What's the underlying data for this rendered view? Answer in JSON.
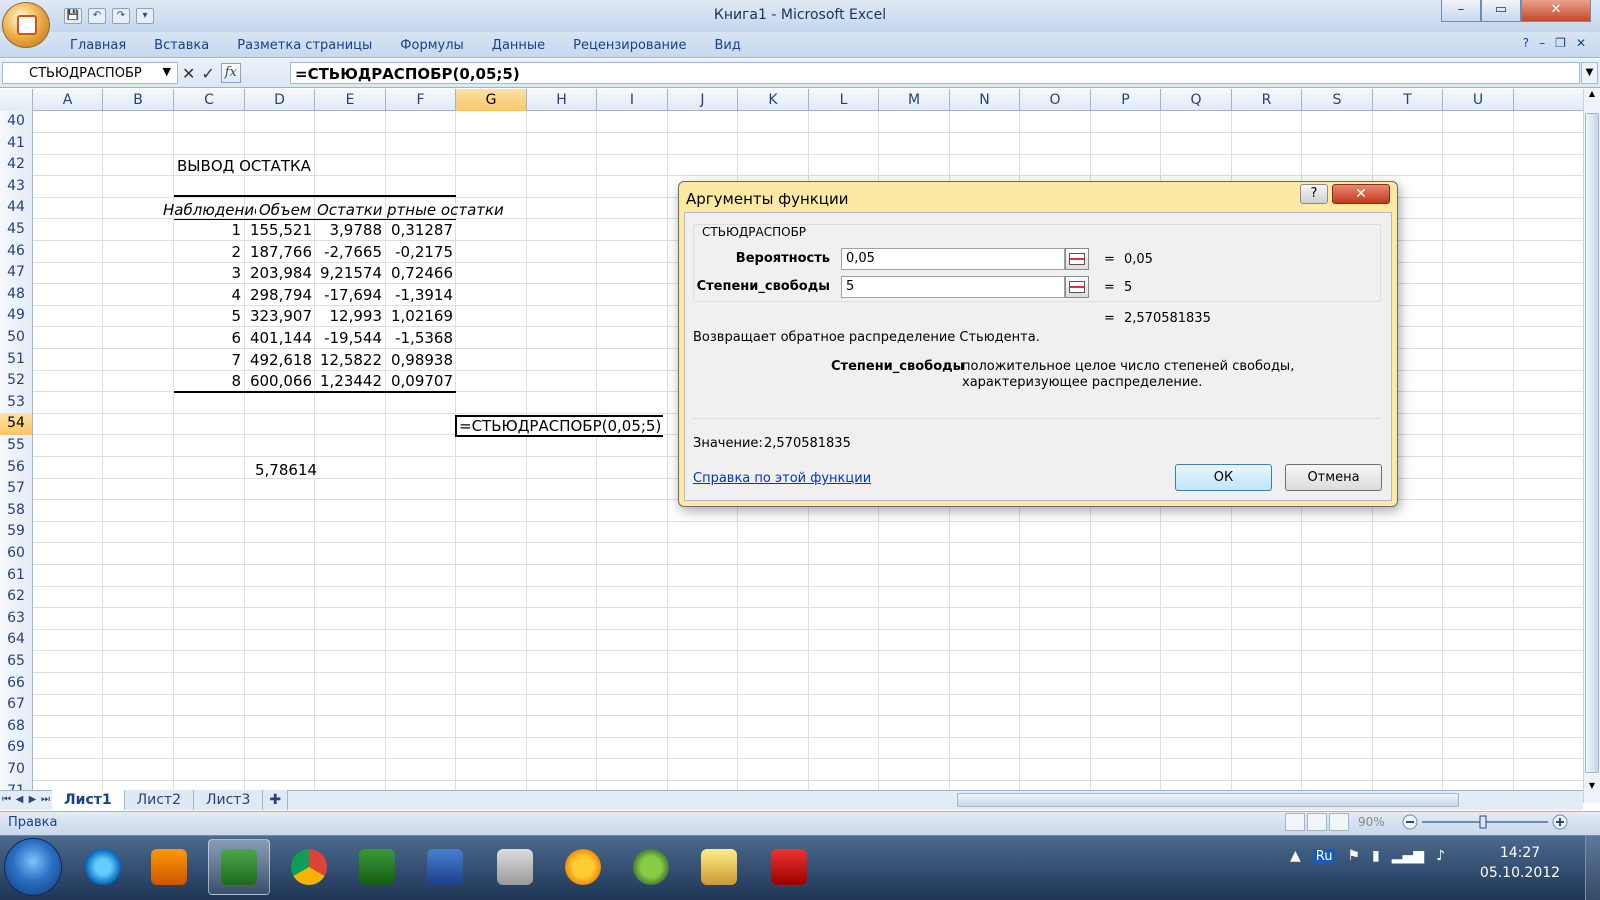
{
  "window": {
    "title": "Книга1 - Microsoft Excel",
    "min": "–",
    "max": "▭",
    "close": "✕"
  },
  "qat": {
    "save": "💾",
    "undo": "↶",
    "redo": "↷",
    "more": "▾"
  },
  "ribbon": {
    "tabs": [
      "Главная",
      "Вставка",
      "Разметка страницы",
      "Формулы",
      "Данные",
      "Рецензирование",
      "Вид"
    ],
    "help": "?",
    "min": "–",
    "restore": "❐",
    "close": "✕"
  },
  "formula_bar": {
    "name_box": "СТЬЮДРАСПОБР",
    "cancel": "✕",
    "enter": "✓",
    "fx": "fx",
    "formula": "=СТЬЮДРАСПОБР(0,05;5)"
  },
  "grid": {
    "columns": [
      "A",
      "B",
      "C",
      "D",
      "E",
      "F",
      "G",
      "H",
      "I",
      "J",
      "K",
      "L",
      "M",
      "N",
      "O",
      "P",
      "Q",
      "R",
      "S",
      "T",
      "U"
    ],
    "rows": [
      "40",
      "41",
      "42",
      "43",
      "44",
      "45",
      "46",
      "47",
      "48",
      "49",
      "50",
      "51",
      "52",
      "53",
      "54",
      "55",
      "56",
      "57",
      "58",
      "59",
      "60",
      "61",
      "62",
      "63",
      "64",
      "65",
      "66",
      "67",
      "68",
      "69",
      "70",
      "71"
    ],
    "section_title": "ВЫВОД ОСТАТКА",
    "headers": {
      "c": "Наблюдение",
      "d": "Объем Е",
      "e": "Остатки",
      "f": "ртные остатки"
    },
    "table": [
      [
        "1",
        "155,521",
        "3,9788",
        "0,31287"
      ],
      [
        "2",
        "187,766",
        "-2,7665",
        "-0,2175"
      ],
      [
        "3",
        "203,984",
        "9,21574",
        "0,72466"
      ],
      [
        "4",
        "298,794",
        "-17,694",
        "-1,3914"
      ],
      [
        "5",
        "323,907",
        "12,993",
        "1,02169"
      ],
      [
        "6",
        "401,144",
        "-19,544",
        "-1,5368"
      ],
      [
        "7",
        "492,618",
        "12,5822",
        "0,98938"
      ],
      [
        "8",
        "600,066",
        "1,23442",
        "0,09707"
      ]
    ],
    "editing_cell": "=СТЬЮДРАСПОБР(0,05;5)",
    "d56": "5,78614"
  },
  "sheets": {
    "tabs": [
      "Лист1",
      "Лист2",
      "Лист3"
    ],
    "active": "Лист1"
  },
  "status": {
    "text": "Правка",
    "zoom": "90%"
  },
  "taskbar": {
    "time": "14:27",
    "date": "05.10.2012",
    "lang": "Ru"
  },
  "dialog": {
    "title": "Аргументы функции",
    "help_btn": "?",
    "close_btn": "✕",
    "function_name": "СТЬЮДРАСПОБР",
    "args": [
      {
        "label": "Вероятность",
        "value": "0,05",
        "result": "0,05"
      },
      {
        "label": "Степени_свободы",
        "value": "5",
        "result": "5"
      }
    ],
    "eq": "=",
    "formula_result": "2,570581835",
    "description": "Возвращает обратное распределение Стьюдента.",
    "param_name": "Степени_свободы",
    "param_desc": "положительное целое число степеней свободы, характеризующее распределение.",
    "value_label": "Значение:",
    "value": "2,570581835",
    "help_link": "Справка по этой функции",
    "ok": "ОК",
    "cancel": "Отмена"
  }
}
